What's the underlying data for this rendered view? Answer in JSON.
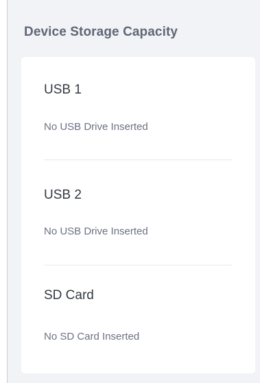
{
  "panel": {
    "title": "Device Storage Capacity"
  },
  "storage": {
    "items": [
      {
        "name": "USB 1",
        "status": "No USB Drive Inserted"
      },
      {
        "name": "USB 2",
        "status": "No USB Drive Inserted"
      },
      {
        "name": "SD Card",
        "status": "No SD Card Inserted"
      }
    ]
  },
  "colors": {
    "panel_background": "#f2f3f7",
    "card_background": "#ffffff",
    "title_text": "#5f6775",
    "item_text": "#333842",
    "status_text": "#6a7180",
    "divider": "#e7e9ee"
  }
}
